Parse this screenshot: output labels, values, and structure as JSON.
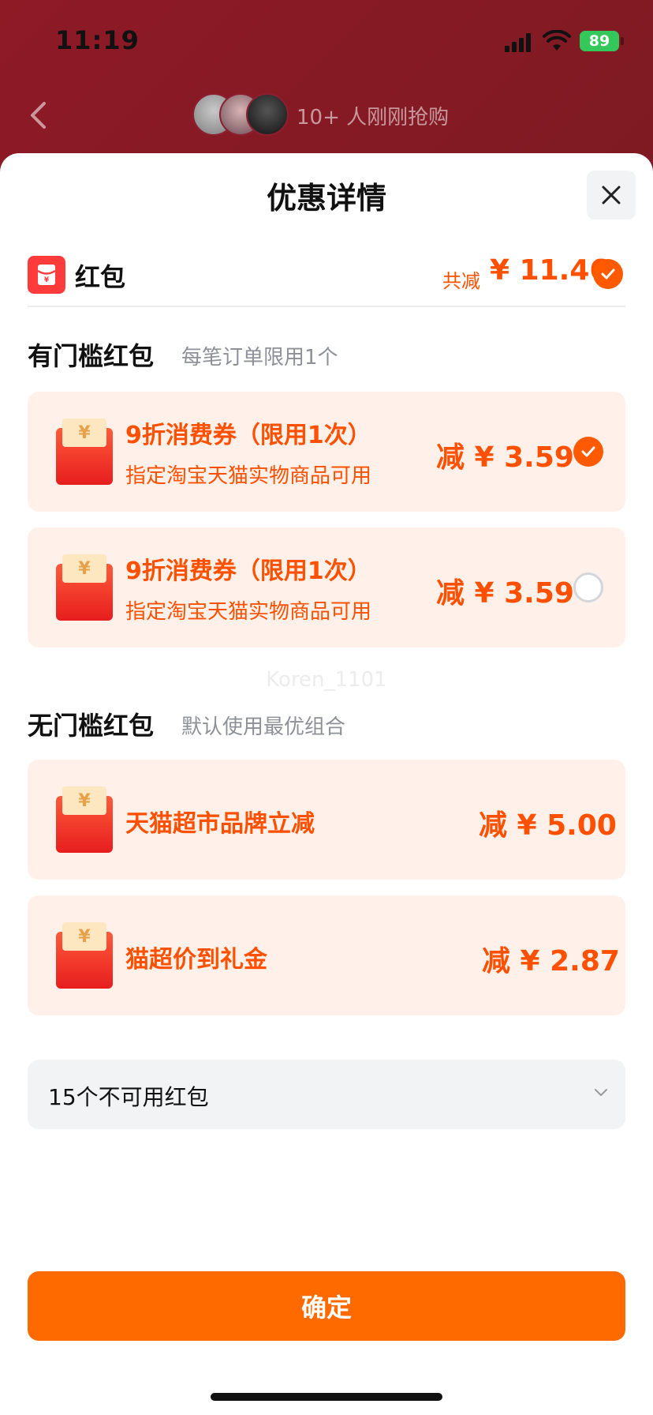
{
  "status_bar": {
    "time": "11:19",
    "battery": "89"
  },
  "background_header": {
    "buyers_text": "10+ 人刚刚抢购"
  },
  "sheet": {
    "title": "优惠详情",
    "summary": {
      "label": "红包",
      "total_prefix": "共减",
      "total_value": "¥ 11.46"
    },
    "threshold_section": {
      "title": "有门槛红包",
      "note": "每笔订单限用1个",
      "coupons": [
        {
          "title": "9折消费券（限用1次）",
          "subtitle": "指定淘宝天猫实物商品可用",
          "amount": "减 ¥ 3.59",
          "selected": true
        },
        {
          "title": "9折消费券（限用1次）",
          "subtitle": "指定淘宝天猫实物商品可用",
          "amount": "减 ¥ 3.59",
          "selected": false
        }
      ]
    },
    "watermark": "Koren_1101",
    "no_threshold_section": {
      "title": "无门槛红包",
      "note": "默认使用最优组合",
      "coupons": [
        {
          "title": "天猫超市品牌立减",
          "amount": "减 ¥ 5.00"
        },
        {
          "title": "猫超价到礼金",
          "amount": "减 ¥ 2.87"
        }
      ]
    },
    "unavailable": {
      "label": "15个不可用红包"
    },
    "confirm_label": "确定"
  },
  "colors": {
    "accent": "#ff5000",
    "button": "#ff6a00",
    "card_bg": "#fff1ea"
  },
  "icons": [
    "back-icon",
    "close-icon",
    "red-packet-icon",
    "check-icon",
    "chevron-down-icon",
    "signal-icon",
    "wifi-icon",
    "battery-icon"
  ]
}
